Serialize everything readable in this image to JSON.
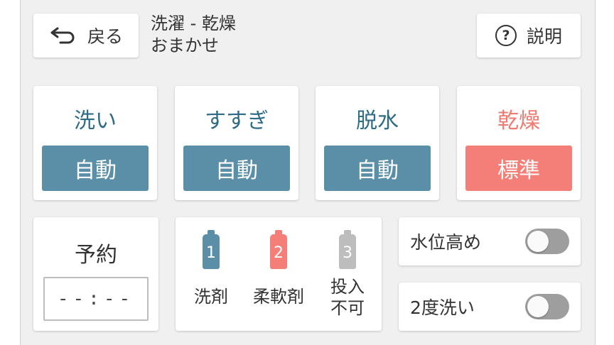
{
  "header": {
    "back_label": "戻る",
    "title_line1": "洗濯 - 乾燥",
    "title_line2": "おまかせ",
    "help_label": "説明"
  },
  "modes": [
    {
      "title": "洗い",
      "value": "自動"
    },
    {
      "title": "すすぎ",
      "value": "自動"
    },
    {
      "title": "脱水",
      "value": "自動"
    },
    {
      "title": "乾燥",
      "value": "標準"
    }
  ],
  "reservation": {
    "title": "予約",
    "time": "--:--"
  },
  "detergents": [
    {
      "number": "1",
      "label": "洗剤"
    },
    {
      "number": "2",
      "label": "柔軟剤"
    },
    {
      "number": "3",
      "label_line1": "投入",
      "label_line2": "不可"
    }
  ],
  "toggles": [
    {
      "label": "水位高め",
      "on": false
    },
    {
      "label": "2度洗い",
      "on": false
    }
  ],
  "colors": {
    "panel_bg": "#f0f0f0",
    "mode_accent": "#5b8fa8",
    "mode_title": "#2e6b86",
    "dry_accent": "#f47f78",
    "detergent_1": "#5b8fa8",
    "softener_2": "#f47f78",
    "disabled_3": "#bdbdbd",
    "toggle_off": "#9e9e9e"
  }
}
